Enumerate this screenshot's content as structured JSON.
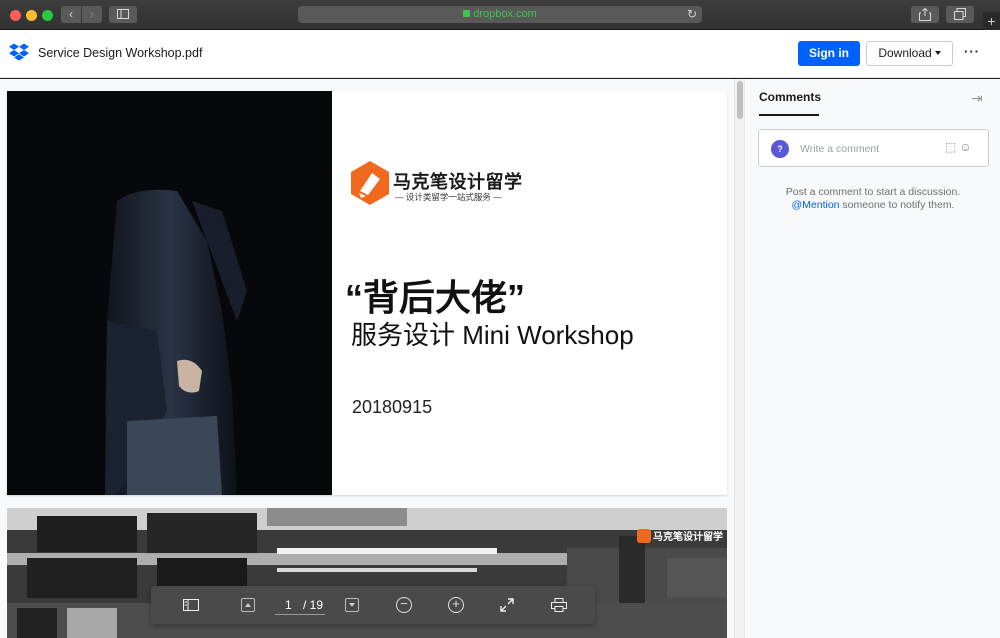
{
  "browser": {
    "url": "dropbox.com",
    "new_tab_label": "+"
  },
  "header": {
    "filename": "Service Design Workshop.pdf",
    "signin_label": "Sign in",
    "download_label": "Download",
    "more_label": "···"
  },
  "slide1": {
    "brand_name": "马克笔设计留学",
    "brand_tagline": "— 设计类留学一站式服务 —",
    "title": "“背后大佬”",
    "subtitle": "服务设计 Mini Workshop",
    "date": "20180915"
  },
  "slide2": {
    "brand_name": "马克笔设计留学"
  },
  "toolbar": {
    "current_page": "1",
    "total_pages": "/ 19"
  },
  "comments": {
    "tab_label": "Comments",
    "input_placeholder": "Write a comment",
    "avatar_letter": "?",
    "hint_line1": "Post a comment to start a discussion.",
    "hint_mention": "@Mention",
    "hint_line2_rest": " someone to notify them."
  },
  "colors": {
    "primary": "#0061fe",
    "brand_orange": "#ef6a1e",
    "avatar": "#5b57d9"
  }
}
